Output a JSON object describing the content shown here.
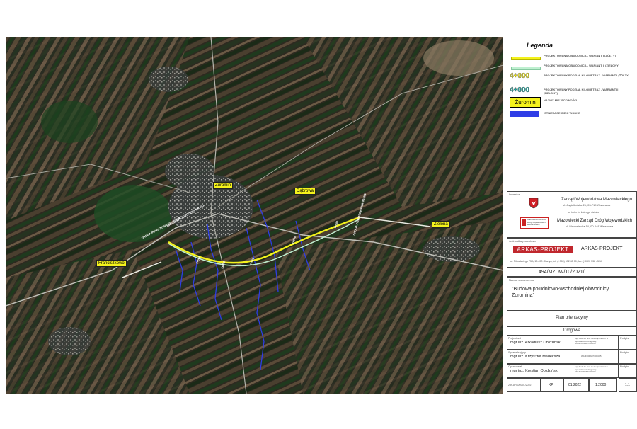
{
  "legend": {
    "title": "Legenda",
    "items": [
      {
        "swatch_color": "#f4f21c",
        "text": "PROJEKTOWANA OBWODNICA - WARIANT I (ŻÓŁTY)"
      },
      {
        "swatch_color": "#bff0d0",
        "text": "PROJEKTOWANA OBWODNICA - WARIANT II (ZIELONY)"
      },
      {
        "swatch_text": "4+000",
        "swatch_color": "#e8e12a",
        "text": "PROJEKTOWANY PODZIAŁ KILOMETRAŻ - WARIANT I (ŻÓŁTY)"
      },
      {
        "swatch_text": "4+000",
        "swatch_color": "#2aa6a0",
        "text": "PROJEKTOWANY PODZIAŁ KILOMETRAŻ - WARIANT II (ZIELONY)"
      },
      {
        "swatch_text": "Żuromin",
        "text": "NAZWY MIEJSCOWOŚCI"
      },
      {
        "swatch_color": "#2f3de6",
        "text": "ISTNIEJĄCE CIEKI WODNE"
      }
    ]
  },
  "title_block": {
    "investor_label": "Inwestor",
    "investor_name": "Zarząd Województwa Mazowieckiego",
    "investor_address": "ul. Jagiellońska 26, 03-719 Warszawa",
    "on_behalf": "w imieniu którego działa",
    "mzdw_logo_text": "Mazowiecki Zarząd Dróg Wojewódzkich w Warszawie",
    "mzdw_name": "Mazowiecki Zarząd Dróg Wojewódzkich",
    "mzdw_address": "ul. Mazowiecka 14, 00-048 Warszawa",
    "designer_label": "Jednostka projektowa",
    "company_logo": "ARKAS-PROJEKT",
    "company_name": "ARKAS-PROJEKT",
    "company_address": "ul. Piłsudskiego 75A, 10-450 Olsztyn, tel. (+089) 532 45 00, fax. (+089) 532 45 10",
    "contract_no": "494/MZDW/10/2021/I",
    "project_label": "Nazwa zamierzenia",
    "project_name": "\"Budowa południowo-wschodniej obwodnicy Żuromina\"",
    "drawing_title": "Plan orientacyjny",
    "branch": "Drogowa",
    "people": [
      {
        "role": "Projektant",
        "name": "mgr inż. Arkadiusz Obidziński",
        "license": "upr.bud. do proj. bez ograniczeń w specjalności drogowej WAM/0014/POOD/06"
      },
      {
        "role": "Sprawdzający",
        "name": "mgr inż. Krzysztof Madeksza",
        "license": "WAM/0009/POOD/05"
      },
      {
        "role": "Opracował",
        "name": "mgr inż. Krystian Obidziński",
        "license": "upr.bud. do proj. bez ograniczeń w specjalności drogowej WAM/0003/POOD/08"
      }
    ],
    "signature_label": "Podpis",
    "bottom": {
      "doc_no": "289-ARKAS/01/2022",
      "scale_word": "KP",
      "date": "01.2022",
      "scale": "1:2000",
      "sheet": "1.1"
    }
  },
  "map": {
    "places": [
      {
        "name": "Żuromin"
      },
      {
        "name": "Dąbrowa"
      },
      {
        "name": "Zielona"
      },
      {
        "name": "Franciszkowo"
      }
    ],
    "road_labels": [
      {
        "text": "DROGA POWIATOWA NR 4636W"
      },
      {
        "text": "DROGA WOJEWÓDZKA NR 541"
      },
      {
        "text": "DROGA POWIATOWA NR 4638W"
      },
      {
        "text": "0+500"
      },
      {
        "text": "1+000"
      },
      {
        "text": "2+000"
      },
      {
        "text": "3+000"
      },
      {
        "text": "4+000"
      }
    ]
  }
}
